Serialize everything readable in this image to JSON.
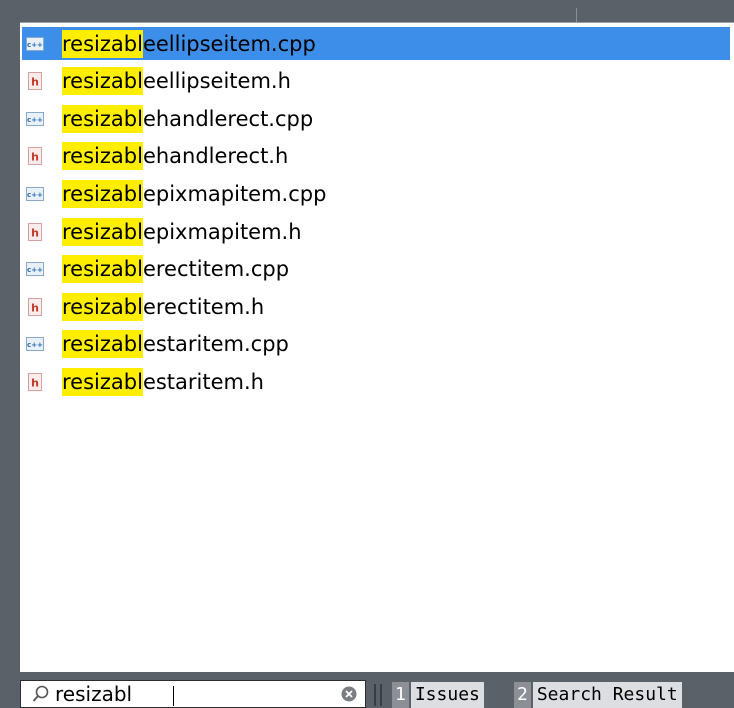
{
  "locator": {
    "results": [
      {
        "match": "resizabl",
        "rest": "eellipseitem.cpp",
        "kind": "cpp",
        "selected": true
      },
      {
        "match": "resizabl",
        "rest": "eellipseitem.h",
        "kind": "h",
        "selected": false
      },
      {
        "match": "resizabl",
        "rest": "ehandlerect.cpp",
        "kind": "cpp",
        "selected": false
      },
      {
        "match": "resizabl",
        "rest": "ehandlerect.h",
        "kind": "h",
        "selected": false
      },
      {
        "match": "resizabl",
        "rest": "epixmapitem.cpp",
        "kind": "cpp",
        "selected": false
      },
      {
        "match": "resizabl",
        "rest": "epixmapitem.h",
        "kind": "h",
        "selected": false
      },
      {
        "match": "resizabl",
        "rest": "erectitem.cpp",
        "kind": "cpp",
        "selected": false
      },
      {
        "match": "resizabl",
        "rest": "erectitem.h",
        "kind": "h",
        "selected": false
      },
      {
        "match": "resizabl",
        "rest": "estaritem.cpp",
        "kind": "cpp",
        "selected": false
      },
      {
        "match": "resizabl",
        "rest": "estaritem.h",
        "kind": "h",
        "selected": false
      }
    ],
    "search": {
      "value": "resizabl"
    }
  },
  "panes": [
    {
      "num": "1",
      "label": "Issues"
    },
    {
      "num": "2",
      "label": "Search Result"
    }
  ],
  "colors": {
    "selection": "#3d8ee9",
    "match_highlight": "#ffee00",
    "background": "#5b6168"
  },
  "icons": {
    "cpp": "cpp-file-icon",
    "h": "header-file-icon",
    "search": "search-icon",
    "clear": "clear-icon"
  }
}
